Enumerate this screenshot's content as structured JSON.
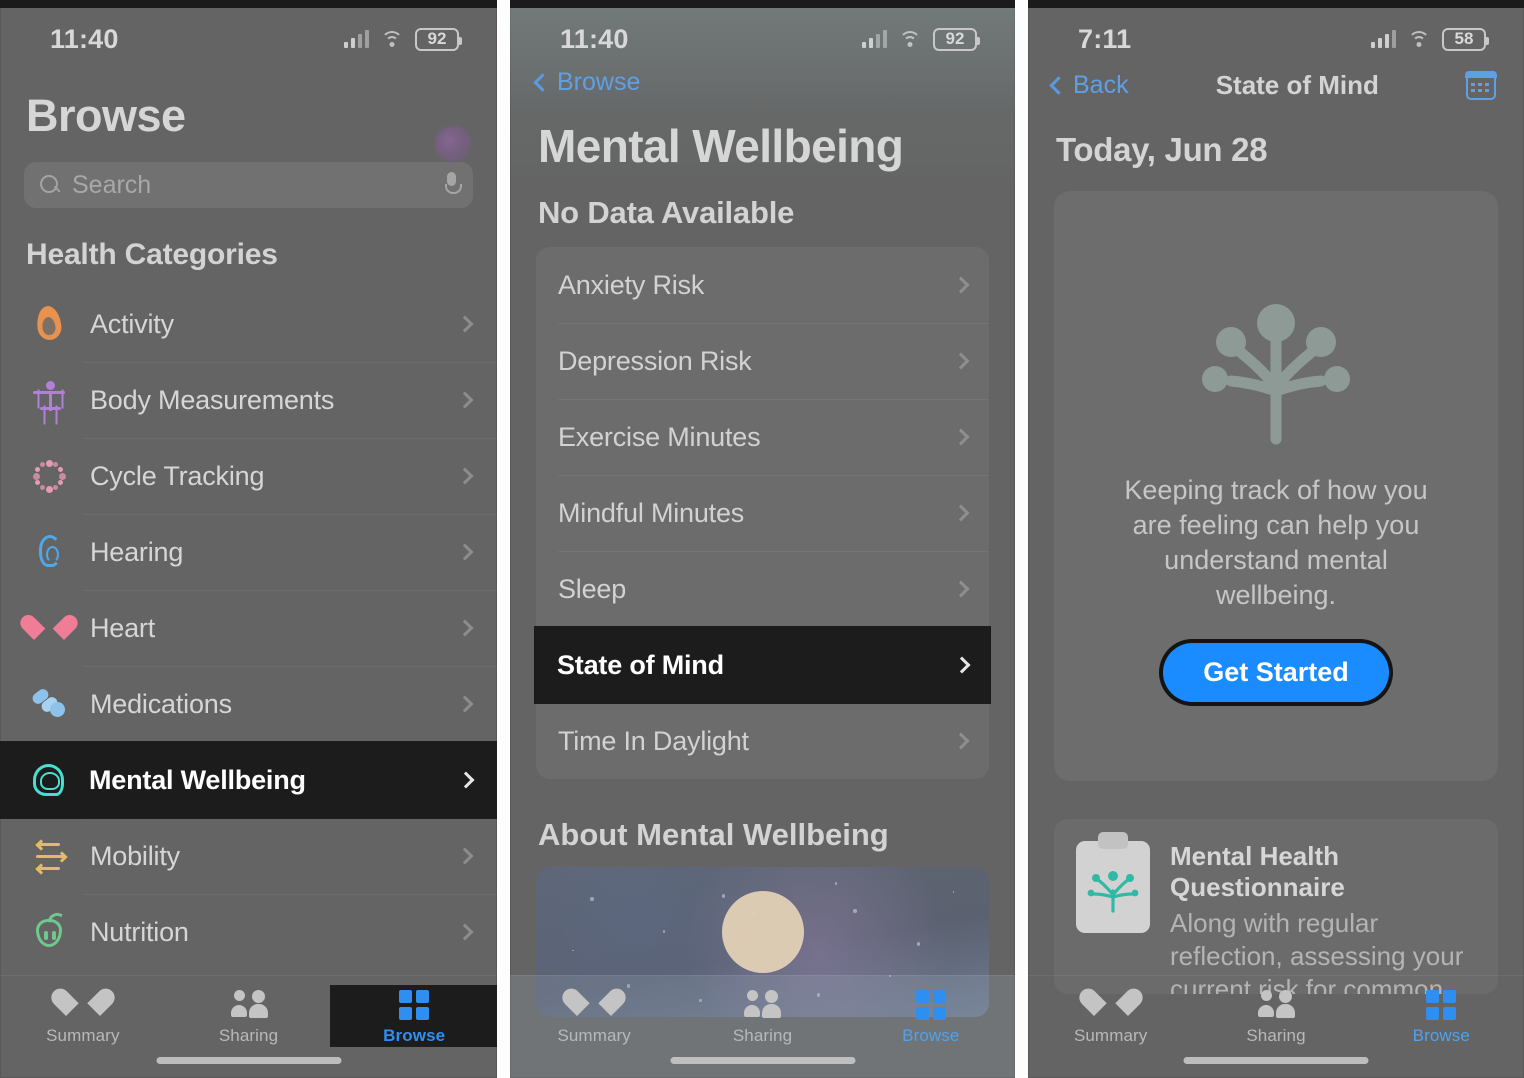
{
  "panel1": {
    "status": {
      "time": "11:40",
      "battery": "92",
      "signal_icon": "cellular-signal-icon",
      "wifi_icon": "wifi-icon"
    },
    "title": "Browse",
    "avatar_name": "profile-avatar",
    "search": {
      "placeholder": "Search",
      "icon": "search-icon",
      "mic_icon": "microphone-icon"
    },
    "section_header": "Health Categories",
    "categories": [
      {
        "label": "Activity",
        "icon": "flame-icon",
        "color": "#e8924e",
        "focused": false
      },
      {
        "label": "Body Measurements",
        "icon": "body-figure-icon",
        "color": "#b081d6",
        "focused": false
      },
      {
        "label": "Cycle Tracking",
        "icon": "cycle-dots-icon",
        "color": "#e79ab4",
        "focused": false
      },
      {
        "label": "Hearing",
        "icon": "ear-icon",
        "color": "#4fa8e8",
        "focused": false
      },
      {
        "label": "Heart",
        "icon": "heart-icon",
        "color": "#ef7d96",
        "focused": false
      },
      {
        "label": "Medications",
        "icon": "pills-icon",
        "color": "#8dc3ea",
        "focused": false
      },
      {
        "label": "Mental Wellbeing",
        "icon": "brain-head-icon",
        "color": "#49ded0",
        "focused": true
      },
      {
        "label": "Mobility",
        "icon": "arrows-icon",
        "color": "#e0bb6a",
        "focused": false
      },
      {
        "label": "Nutrition",
        "icon": "apple-icon",
        "color": "#6fc98d",
        "focused": false
      }
    ],
    "tabs": [
      {
        "label": "Summary",
        "icon": "heart-tab-icon",
        "active": false,
        "focused": false
      },
      {
        "label": "Sharing",
        "icon": "people-tab-icon",
        "active": false,
        "focused": false
      },
      {
        "label": "Browse",
        "icon": "grid-tab-icon",
        "active": true,
        "focused": true
      }
    ]
  },
  "panel2": {
    "status": {
      "time": "11:40",
      "battery": "92",
      "signal_icon": "cellular-signal-icon",
      "wifi_icon": "wifi-icon"
    },
    "back_label": "Browse",
    "title": "Mental Wellbeing",
    "section_header": "No Data Available",
    "rows": [
      {
        "label": "Anxiety Risk",
        "focused": false
      },
      {
        "label": "Depression Risk",
        "focused": false
      },
      {
        "label": "Exercise Minutes",
        "focused": false
      },
      {
        "label": "Mindful Minutes",
        "focused": false
      },
      {
        "label": "Sleep",
        "focused": false
      },
      {
        "label": "State of Mind",
        "focused": true
      },
      {
        "label": "Time In Daylight",
        "focused": false
      }
    ],
    "about_header": "About Mental Wellbeing",
    "about_image_name": "night-sky-moon-image",
    "tabs": [
      {
        "label": "Summary",
        "icon": "heart-tab-icon",
        "active": false
      },
      {
        "label": "Sharing",
        "icon": "people-tab-icon",
        "active": false
      },
      {
        "label": "Browse",
        "icon": "grid-tab-icon",
        "active": true
      }
    ]
  },
  "panel3": {
    "status": {
      "time": "7:11",
      "battery": "58",
      "signal_icon": "cellular-signal-icon",
      "wifi_icon": "wifi-icon"
    },
    "back_label": "Back",
    "title": "State of Mind",
    "calendar_icon": "calendar-icon",
    "date": "Today, Jun 28",
    "empty": {
      "illustration": "sprout-blossom-icon",
      "message": "Keeping track of how you are feeling can help you understand mental wellbeing.",
      "button_label": "Get Started",
      "button_color": "#1a8cff"
    },
    "questionnaire": {
      "icon": "clipboard-plant-icon",
      "title": "Mental Health Questionnaire",
      "body": "Along with regular reflection, assessing your current risk for common conditions can be an"
    },
    "tabs": [
      {
        "label": "Summary",
        "icon": "heart-tab-icon",
        "active": false
      },
      {
        "label": "Sharing",
        "icon": "people-tab-icon",
        "active": false
      },
      {
        "label": "Browse",
        "icon": "grid-tab-icon",
        "active": true
      }
    ]
  }
}
